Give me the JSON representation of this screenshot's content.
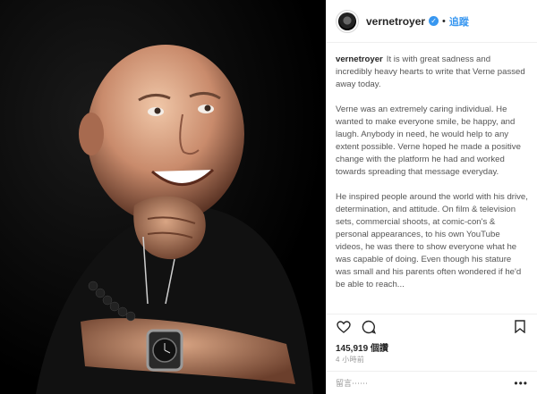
{
  "header": {
    "username": "vernetroyer",
    "verified_icon": "check-icon",
    "follow_label": "追蹤"
  },
  "caption": {
    "username": "vernetroyer",
    "paragraphs": [
      "It is with great sadness and incredibly heavy hearts to write that Verne passed away today.",
      "Verne was an extremely caring individual. He wanted to make everyone smile, be happy, and laugh. Anybody in need, he would help to any extent possible. Verne hoped he made a positive change with the platform he had and worked towards spreading that message everyday.",
      "He inspired people around the world with his drive, determination, and attitude. On film & television sets, commercial shoots, at comic-con's & personal appearances, to his own YouTube videos, he was there to show everyone what he was capable of doing. Even though his stature was small and his parents often wondered if he'd be able to reach..."
    ]
  },
  "stats": {
    "likes": "145,919 個讚",
    "time_ago": "4 小時前"
  },
  "comment": {
    "placeholder": "留言⋯⋯",
    "more": "•••"
  }
}
